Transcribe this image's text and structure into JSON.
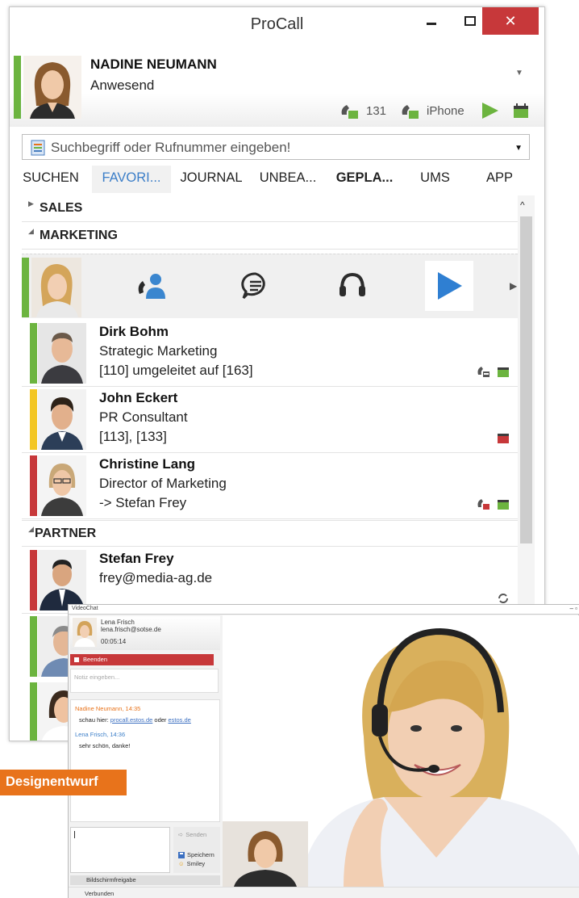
{
  "window": {
    "title": "ProCall"
  },
  "me": {
    "name": "NADINE NEUMANN",
    "presence": "Anwesend",
    "line_number": "131",
    "line_device": "iPhone"
  },
  "search": {
    "placeholder": "Suchbegriff oder Rufnummer eingeben!"
  },
  "tabs": [
    {
      "label": "SUCHEN"
    },
    {
      "label": "FAVORI..."
    },
    {
      "label": "JOURNAL"
    },
    {
      "label": "UNBEA..."
    },
    {
      "label": "GEPLA..."
    },
    {
      "label": "UMS"
    },
    {
      "label": "APP"
    }
  ],
  "groups": {
    "sales": "SALES",
    "marketing": "MARKETING",
    "partner": "PARTNER"
  },
  "contacts": [
    {
      "name": "Dirk Bohm",
      "title": "Strategic Marketing",
      "info": "[110] umgeleitet auf [163]",
      "status_color": "#6cb43f"
    },
    {
      "name": "John Eckert",
      "title": "PR Consultant",
      "info": "[113], [133]",
      "status_color": "#f3c623"
    },
    {
      "name": "Christine Lang",
      "title": "Director of Marketing",
      "info": "-> Stefan Frey",
      "status_color": "#c7383a"
    },
    {
      "name": "Stefan Frey",
      "title": "frey@media-ag.de",
      "info": "",
      "status_color": "#c7383a"
    }
  ],
  "videochat": {
    "title": "VideoChat",
    "peer_name": "Lena Frisch",
    "peer_email": "lena.frisch@sotse.de",
    "duration": "00:05:14",
    "end_label": "Beenden",
    "note_placeholder": "Notiz eingeben...",
    "messages": [
      {
        "author": "Nadine Neumann, 14:35",
        "text_prefix": "schau hier: ",
        "link1": "procall.estos.de",
        "middle": " oder ",
        "link2": "estos.de"
      },
      {
        "author": "Lena Frisch, 14:36",
        "text": "sehr schön, danke!"
      }
    ],
    "send_label": "Senden",
    "save_label": "Speichern",
    "smiley_label": "Smiley",
    "share_label": "Bildschirmfreigabe",
    "status_label": "Verbunden"
  },
  "badge": {
    "label": "Designentwurf"
  },
  "colors": {
    "accent": "#3b7ec8",
    "available": "#6cb43f",
    "away": "#f3c623",
    "busy": "#c7383a",
    "badge": "#e8731b"
  }
}
